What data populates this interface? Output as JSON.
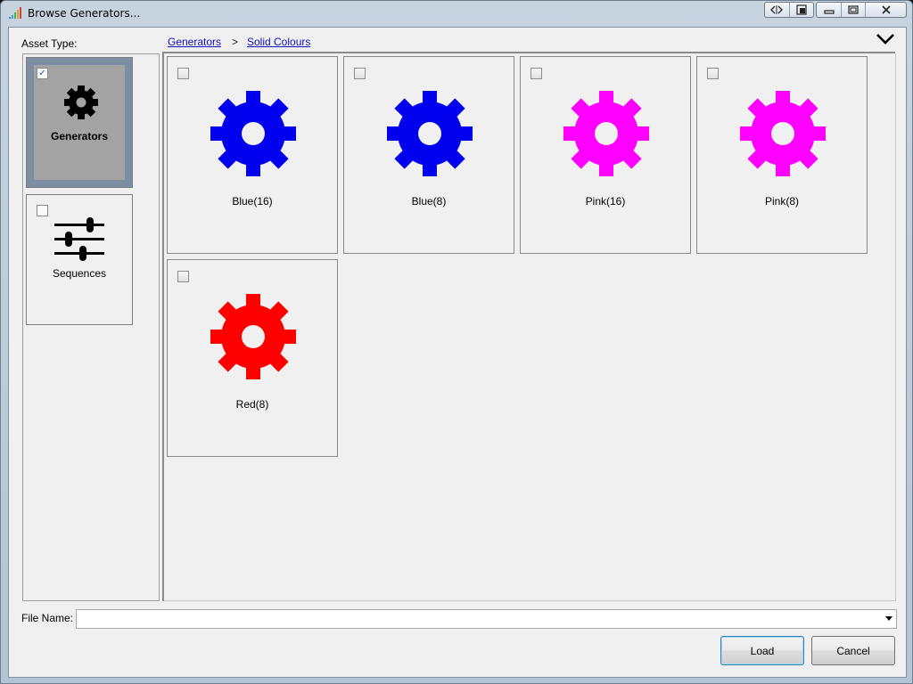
{
  "window": {
    "title": "Browse Generators..."
  },
  "breadcrumb": {
    "label": "Asset Type:",
    "items": [
      "Generators",
      "Solid Colours"
    ],
    "separator": ">"
  },
  "sidebar": {
    "items": [
      {
        "label": "Generators",
        "checked": true,
        "selected": true,
        "icon": "gear-icon"
      },
      {
        "label": "Sequences",
        "checked": false,
        "selected": false,
        "icon": "sliders-icon"
      }
    ]
  },
  "tiles": [
    {
      "name": "Blue(16)",
      "color": "#0000ee",
      "checked": false
    },
    {
      "name": "Blue(8)",
      "color": "#0000ee",
      "checked": false
    },
    {
      "name": "Pink(16)",
      "color": "#ff00ff",
      "checked": false
    },
    {
      "name": "Pink(8)",
      "color": "#ff00ff",
      "checked": false
    },
    {
      "name": "Red(8)",
      "color": "#ff0000",
      "checked": false
    }
  ],
  "file": {
    "label": "File Name:",
    "value": ""
  },
  "buttons": {
    "load": "Load",
    "cancel": "Cancel"
  },
  "checkmark": "✓"
}
